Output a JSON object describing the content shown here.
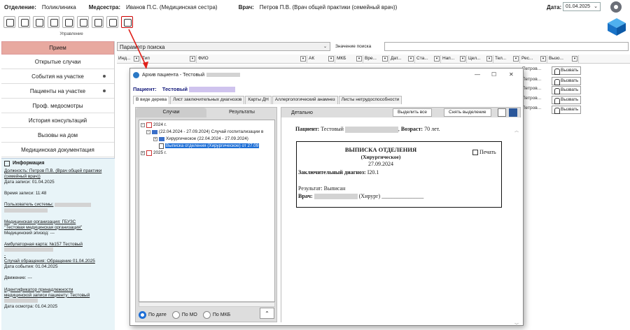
{
  "topbar": {
    "department_label": "Отделение:",
    "department_value": "Поликлиника",
    "nurse_label": "Медсестра:",
    "nurse_value": "Иванов П.С. (Медицинская сестра)",
    "doctor_label": "Врач:",
    "doctor_value": "Петров П.В. (Врач общей практики (семейный врач))",
    "date_label": "Дата:",
    "date_value": "01.04.2025"
  },
  "toolbar": {
    "caption": "Управление",
    "buttons": [
      "patient-icon",
      "document-add-icon",
      "patients-icon",
      "edit-document-icon",
      "schedule-icon",
      "visit-icon",
      "archive-box-icon",
      "calendar-icon",
      "archive-icon"
    ]
  },
  "sidebar": {
    "header": "Прием",
    "items": [
      {
        "label": "Открытые случаи"
      },
      {
        "label": "События на участке"
      },
      {
        "label": "Пациенты на участке"
      },
      {
        "label": "Проф. медосмотры"
      },
      {
        "label": "История консультаций"
      },
      {
        "label": "Вызовы на дом"
      },
      {
        "label": "Медицинская документация"
      }
    ]
  },
  "info": {
    "title": "Информация",
    "position": "Должность: Петров П.В. (Врач общей практики (семейный врач))",
    "record_date": "Дата записи: 01.04.2025",
    "record_time": "Время записи: 11:48",
    "system_user": "Пользователь системы:",
    "org_line1": "Медицинская организация: ГБУЗС",
    "org_line2": "\"Тестовая медицинская организация\"",
    "episode": "Медицинский эпизод: ---",
    "card": "Амбулаторная карта: №157 Тестовый",
    "card_tail": "-",
    "case": "Случай обращения: Обращение 01.04.2025",
    "event_date": "Дата события: 01.04.2025",
    "movement": "Движение: ---",
    "ident_line1": "Идентификатор принадлежности",
    "ident_line2": "медицинской записи пациенту: Тестовый",
    "exam_date": "Дата осмотра: 01.04.2025"
  },
  "grid": {
    "search_param_label": "Параметр поиска",
    "search_value_label": "Значение поиска",
    "columns": [
      "Инд...",
      "Тип",
      "ФИО",
      "АК",
      "МКБ",
      "Вре...",
      "Дат...",
      "Ста...",
      "Нап...",
      "Цел...",
      "Тел...",
      "Рес...",
      "Вызо..."
    ],
    "rows": [
      {
        "doctor": "Петров...",
        "call": "Вызвать"
      },
      {
        "doctor": "Петров...",
        "call": "Вызвать"
      },
      {
        "doctor": "Петров...",
        "call": "Вызвать"
      },
      {
        "doctor": "Петров...",
        "call": "Вызвать"
      },
      {
        "doctor": "Петров...",
        "call": "Вызвать"
      }
    ]
  },
  "modal": {
    "title": "Архив пациента - Тестовый",
    "patient_label": "Пациент:",
    "patient_name": "Тестовый",
    "tabs": [
      "В виде дерева",
      "Лист заключительных диагнозов",
      "Карты ДН",
      "Аллергологический анамнез",
      "Листы нетрудоспособности"
    ],
    "subtabs": [
      "Случаи",
      "Результаты"
    ],
    "tree": {
      "year1": "2024 г.",
      "case": "(22.04.2024 - 27.09.2024) Случай госпитализации в",
      "dept": "Хирургическое (22.04.2024 - 27.09.2024)",
      "doc": "Выписка отделения (Хирургическое) от 27.09",
      "year2": "2025 г."
    },
    "radio": [
      "По дате",
      "По МО",
      "По МКБ"
    ],
    "detail_label": "Детально",
    "select_all": "Выделить все",
    "deselect": "Снять выделение",
    "document": {
      "patient_label": "Пациент:",
      "patient_name": "Тестовый",
      "age_label": "Возраст:",
      "age_value": "70 лет.",
      "title": "ВЫПИСКА ОТДЕЛЕНИЯ",
      "subtitle": "(Хирургическое)",
      "date": "27.09.2024",
      "print_label": "Печать",
      "diag_label": "Заключительный диагноз:",
      "diag_value": "I20.1",
      "result": "Результат: Выписан",
      "doctor_label": "Врач:",
      "doctor_suffix": "(Хирург) _______________"
    }
  },
  "colors": {
    "sidebar_header": "#e8a9a0",
    "info_bg": "#e8f4f8",
    "accent_blue": "#1e6fd6",
    "patient_title": "#13197a"
  }
}
